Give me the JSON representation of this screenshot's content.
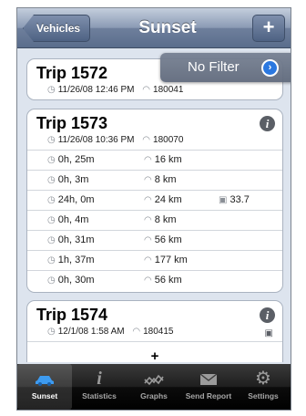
{
  "navbar": {
    "back_label": "Vehicles",
    "title": "Sunset",
    "add_label": "+"
  },
  "filter": {
    "label": "No Filter",
    "arrow": "›"
  },
  "trips": [
    {
      "title": "Trip 1572",
      "date": "11/26/08 12:46 PM",
      "odometer": "180041"
    },
    {
      "title": "Trip 1573",
      "date": "11/26/08 10:36 PM",
      "odometer": "180070",
      "legs": [
        {
          "time": "0h, 25m",
          "distance": "16 km",
          "fuel": ""
        },
        {
          "time": "0h, 3m",
          "distance": "8 km",
          "fuel": ""
        },
        {
          "time": "24h, 0m",
          "distance": "24 km",
          "fuel": "33.7"
        },
        {
          "time": "0h, 4m",
          "distance": "8 km",
          "fuel": ""
        },
        {
          "time": "0h, 31m",
          "distance": "56 km",
          "fuel": ""
        },
        {
          "time": "1h, 37m",
          "distance": "177 km",
          "fuel": ""
        },
        {
          "time": "0h, 30m",
          "distance": "56 km",
          "fuel": ""
        }
      ]
    },
    {
      "title": "Trip 1574",
      "date": "12/1/08 1:58 AM",
      "odometer": "180415"
    }
  ],
  "add_row_label": "+",
  "tabs": [
    {
      "label": "Sunset",
      "icon": "car-icon",
      "active": true
    },
    {
      "label": "Statistics",
      "icon": "info-icon"
    },
    {
      "label": "Graphs",
      "icon": "graphs-icon"
    },
    {
      "label": "Send Report",
      "icon": "envelope-icon"
    },
    {
      "label": "Settings",
      "icon": "gear-icon"
    }
  ],
  "colors": {
    "accent": "#2b78e0",
    "active_tab_icon": "#3d9bf0"
  }
}
